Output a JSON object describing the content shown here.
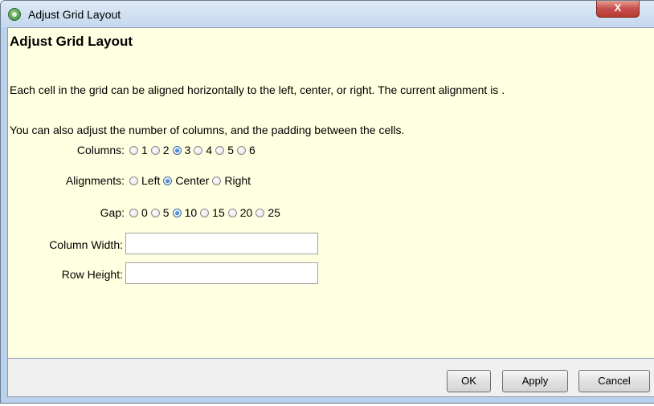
{
  "window": {
    "title": "Adjust Grid Layout",
    "close_label": "X"
  },
  "content": {
    "heading": "Adjust Grid Layout",
    "description1": "Each cell in the grid can be aligned horizontally to the left, center, or right. The current alignment is .",
    "description2": "You can also adjust the number of columns, and the padding between the cells."
  },
  "columns": {
    "label": "Columns:",
    "options": [
      "1",
      "2",
      "3",
      "4",
      "5",
      "6"
    ],
    "selected": "3"
  },
  "alignments": {
    "label": "Alignments:",
    "options": [
      "Left",
      "Center",
      "Right"
    ],
    "selected": "Center"
  },
  "gap": {
    "label": "Gap:",
    "options": [
      "0",
      "5",
      "10",
      "15",
      "20",
      "25"
    ],
    "selected": "10"
  },
  "column_width": {
    "label": "Column Width:",
    "value": ""
  },
  "row_height": {
    "label": "Row Height:",
    "value": ""
  },
  "buttons": {
    "ok": "OK",
    "apply": "Apply",
    "cancel": "Cancel"
  },
  "icons": {
    "app": "app-globe-icon",
    "close": "close-icon"
  },
  "colors": {
    "content_bg": "#ffffe1",
    "close_button": "#c75050"
  }
}
